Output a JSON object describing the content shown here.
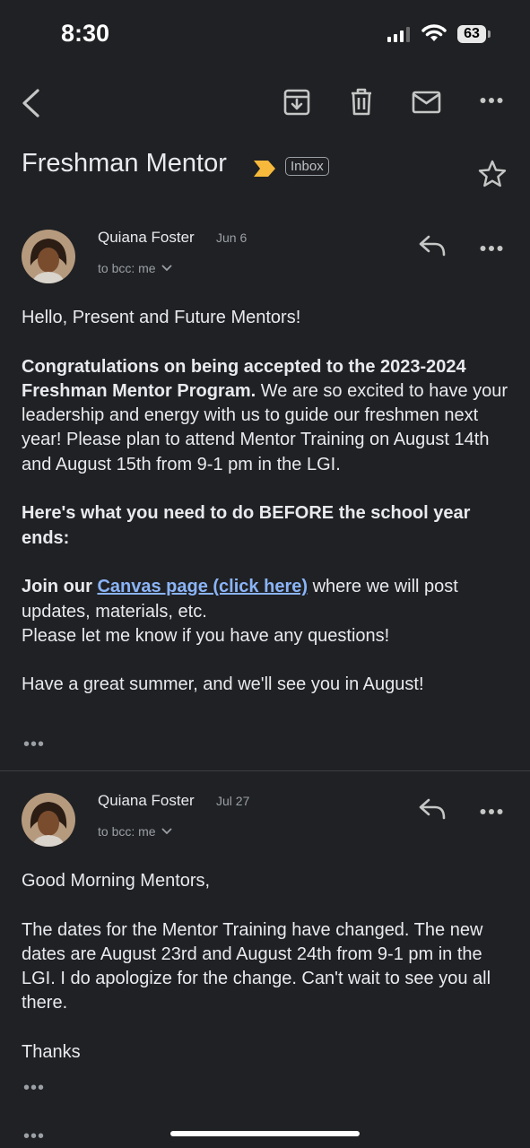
{
  "status_bar": {
    "time": "8:30",
    "battery": "63"
  },
  "thread": {
    "subject": "Freshman Mentor",
    "label": "Inbox"
  },
  "messages": [
    {
      "sender": "Quiana Foster",
      "date": "Jun 6",
      "to": "to bcc: me",
      "greeting": "Hello, Present and Future Mentors!",
      "p1_bold": "Congratulations on being accepted to the 2023-2024 Freshman Mentor Program.",
      "p1_rest": " We are so excited to have your leadership and energy with us to guide our freshmen next year! Please plan to attend Mentor Training on August 14th and August 15th from 9-1 pm in the LGI.",
      "p2_bold": "Here's what you need to do BEFORE the school year ends:",
      "p3_bold": "Join our ",
      "p3_link": "Canvas page (click here)",
      "p3_rest": " where we will post updates, materials, etc.",
      "p3_line2": "Please let me know if you have any questions!",
      "closing": "Have a great summer, and we'll see you in August!"
    },
    {
      "sender": "Quiana Foster",
      "date": "Jul 27",
      "to": "to bcc: me",
      "greeting": "Good Morning Mentors,",
      "p1": "The dates for the Mentor Training have changed. The new dates are August 23rd and August 24th from 9-1 pm in the LGI. I do apologize for the change. Can't wait to see you all there.",
      "closing": "Thanks"
    }
  ],
  "ellipsis": "•••",
  "colors": {
    "background": "#202124",
    "link": "#8ab4f8",
    "important": "#f6b93b"
  }
}
